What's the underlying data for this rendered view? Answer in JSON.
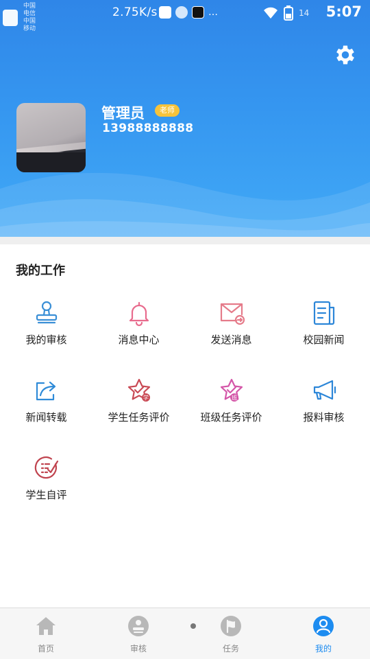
{
  "status_bar": {
    "carrier": "中国电信 中国移动",
    "speed": "2.75K/s",
    "battery": "14",
    "time": "5:07"
  },
  "profile": {
    "name": "管理员",
    "role": "老师",
    "phone": "13988888888"
  },
  "section": {
    "title": "我的工作"
  },
  "work_items": [
    {
      "label": "我的审核",
      "icon": "stamp-icon",
      "color": "#3a8fd6"
    },
    {
      "label": "消息中心",
      "icon": "bell-icon",
      "color": "#e86b8d"
    },
    {
      "label": "发送消息",
      "icon": "mail-send-icon",
      "color": "#e57b8a"
    },
    {
      "label": "校园新闻",
      "icon": "news-icon",
      "color": "#2c86d8"
    },
    {
      "label": "新闻转载",
      "icon": "share-icon",
      "color": "#2f8bd8"
    },
    {
      "label": "学生任务评价",
      "icon": "star-student-icon",
      "color": "#c94a55"
    },
    {
      "label": "班级任务评价",
      "icon": "star-class-icon",
      "color": "#d456a8"
    },
    {
      "label": "报料审核",
      "icon": "megaphone-icon",
      "color": "#2c86d8"
    },
    {
      "label": "学生自评",
      "icon": "self-eval-icon",
      "color": "#c0444f"
    }
  ],
  "bottom_nav": {
    "items": [
      {
        "label": "首页",
        "icon": "home-icon"
      },
      {
        "label": "审核",
        "icon": "audit-icon"
      },
      {
        "label": "任务",
        "icon": "flag-icon"
      },
      {
        "label": "我的",
        "icon": "user-icon"
      }
    ],
    "active": "我的",
    "active_color": "#1d8cf0",
    "inactive_color": "#b8b8b8"
  },
  "colors": {
    "header_top": "#2f86e8",
    "header_bottom": "#41a9f6",
    "badge": "#f6c33b"
  }
}
